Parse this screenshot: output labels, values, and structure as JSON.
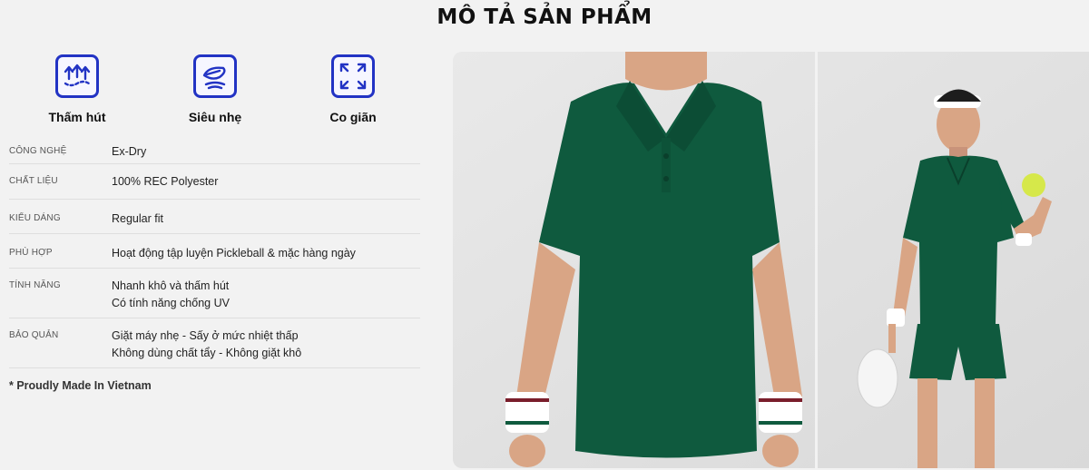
{
  "section_title": "MÔ TẢ SẢN PHẨM",
  "features": [
    {
      "label": "Thấm hút",
      "icon": "moisture-wicking-icon"
    },
    {
      "label": "Siêu nhẹ",
      "icon": "feather-light-icon"
    },
    {
      "label": "Co giãn",
      "icon": "stretch-icon"
    }
  ],
  "specs": [
    {
      "key": "CÔNG NGHỆ",
      "values": [
        "Ex-Dry"
      ]
    },
    {
      "key": "CHẤT LIỆU",
      "values": [
        "100% REC Polyester"
      ]
    },
    {
      "key": "KIỂU DÁNG",
      "values": [
        "Regular fit"
      ]
    },
    {
      "key": "PHÙ HỢP",
      "values": [
        "Hoạt động tập luyện Pickleball & mặc hàng ngày"
      ]
    },
    {
      "key": "TÍNH NĂNG",
      "values": [
        "Nhanh khô và thấm hút",
        "Có tính năng chống UV"
      ]
    },
    {
      "key": "BẢO QUẢN",
      "values": [
        "Giặt máy nhẹ - Sấy ở mức nhiệt thấp",
        "Không dùng chất tẩy - Không giặt khô"
      ]
    }
  ],
  "note": "* Proudly Made In Vietnam",
  "colors": {
    "accent_icon": "#2233c4",
    "shirt_green": "#0f5a3e",
    "background": "#f2f2f2"
  }
}
